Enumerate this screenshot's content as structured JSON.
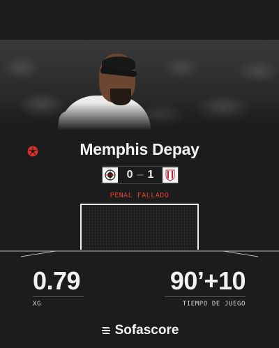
{
  "player": {
    "name": "Memphis Depay"
  },
  "match": {
    "home_score": "0",
    "away_score": "1",
    "home_crest": "corinthians-crest-icon",
    "away_crest": "estudiantes-crest-icon"
  },
  "event": {
    "label": "PENAL FALLADO",
    "color": "#e0402e"
  },
  "stats": {
    "xg_value": "0.79",
    "xg_label": "XG",
    "time_value": "90’+10",
    "time_label": "TIEMPO DE JUEGO"
  },
  "brand": {
    "name": "Sofascore",
    "icon": "sofascore-logo-icon"
  },
  "colors": {
    "background": "#1c1c1c",
    "accent": "#e0402e",
    "text": "#f2f2f2"
  },
  "icons": {
    "event_icon": "soccer-ball-icon"
  }
}
